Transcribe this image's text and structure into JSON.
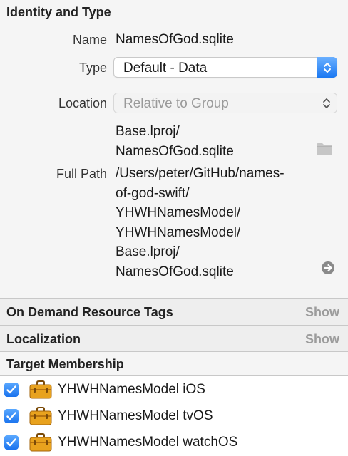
{
  "identity": {
    "title": "Identity and Type",
    "name_label": "Name",
    "name_value": "NamesOfGod.sqlite",
    "type_label": "Type",
    "type_value": "Default - Data",
    "location_label": "Location",
    "location_value": "Relative to Group",
    "location_path": [
      "Base.lproj/",
      "NamesOfGod.sqlite"
    ],
    "fullpath_label": "Full Path",
    "fullpath_lines": [
      "/Users/peter/GitHub/names-",
      "of-god-swift/",
      "YHWHNamesModel/",
      "YHWHNamesModel/",
      "Base.lproj/",
      "NamesOfGod.sqlite"
    ]
  },
  "on_demand": {
    "title": "On Demand Resource Tags",
    "show_label": "Show"
  },
  "localization": {
    "title": "Localization",
    "show_label": "Show"
  },
  "target_membership": {
    "title": "Target Membership",
    "targets": [
      {
        "name": "YHWHNamesModel iOS",
        "checked": true
      },
      {
        "name": "YHWHNamesModel tvOS",
        "checked": true
      },
      {
        "name": "YHWHNamesModel watchOS",
        "checked": true
      }
    ]
  },
  "colors": {
    "accent": "#1a78f2",
    "toolbox": "#e8a21e"
  },
  "icons": [
    "chevron-updown-icon",
    "folder-icon",
    "arrow-circle-right-icon",
    "checkmark-icon",
    "toolbox-icon"
  ]
}
